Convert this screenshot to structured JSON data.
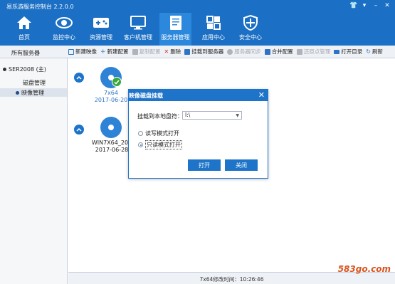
{
  "window": {
    "title": "易乐游服务控制台 2.2.0.0",
    "controls": [
      "👕",
      "▾",
      "–",
      "✕"
    ]
  },
  "nav": [
    {
      "label": "首页",
      "icon": "home-icon"
    },
    {
      "label": "监控中心",
      "icon": "eye-icon"
    },
    {
      "label": "资源管理",
      "icon": "gamepad-icon"
    },
    {
      "label": "客户机管理",
      "icon": "monitor-icon"
    },
    {
      "label": "服务器管理",
      "icon": "server-document-icon"
    },
    {
      "label": "应用中心",
      "icon": "apps-icon"
    },
    {
      "label": "安全中心",
      "icon": "shield-icon"
    }
  ],
  "sidebar": {
    "header": "所有服务器",
    "server": "SER2008 (主)",
    "children": [
      "磁盘管理",
      "映像管理"
    ]
  },
  "toolbar": [
    {
      "label": "新建映像",
      "enabled": true,
      "color": "#2f74c4"
    },
    {
      "label": "新建配置",
      "enabled": true,
      "color": "#2f74c4"
    },
    {
      "label": "复制配置",
      "enabled": false,
      "color": "#b0b4ba"
    },
    {
      "label": "删除",
      "enabled": true,
      "color": "#d0392b"
    },
    {
      "label": "挂载到服务器",
      "enabled": true,
      "color": "#2f74c4"
    },
    {
      "label": "服务器同步",
      "enabled": false,
      "color": "#b0b4ba"
    },
    {
      "label": "合并配置",
      "enabled": true,
      "color": "#2f74c4"
    },
    {
      "label": "还原点管理",
      "enabled": false,
      "color": "#b0b4ba"
    },
    {
      "label": "打开目录",
      "enabled": true,
      "color": "#2f74c4"
    },
    {
      "label": "刷新",
      "enabled": true,
      "color": "#2f74c4"
    }
  ],
  "images": [
    {
      "name": "7x64",
      "date": "2017-06-20",
      "selected": true
    },
    {
      "name": "WIN7X64_200",
      "date": "2017-06-28",
      "selected": false
    }
  ],
  "status": "7x64修改时间：10:26:46",
  "watermark": "583go.com",
  "dialog": {
    "title": "映像磁盘挂载",
    "drive_label": "挂载到本地盘符：",
    "drive_value": "I:\\",
    "options": [
      {
        "label": "读写模式打开",
        "checked": false
      },
      {
        "label": "只读模式打开",
        "checked": true
      }
    ],
    "open_button": "打开",
    "close_button": "关闭"
  },
  "colors": {
    "header": "#1b6fc4",
    "accent": "#1e74c9",
    "check": "#3aa83e"
  }
}
